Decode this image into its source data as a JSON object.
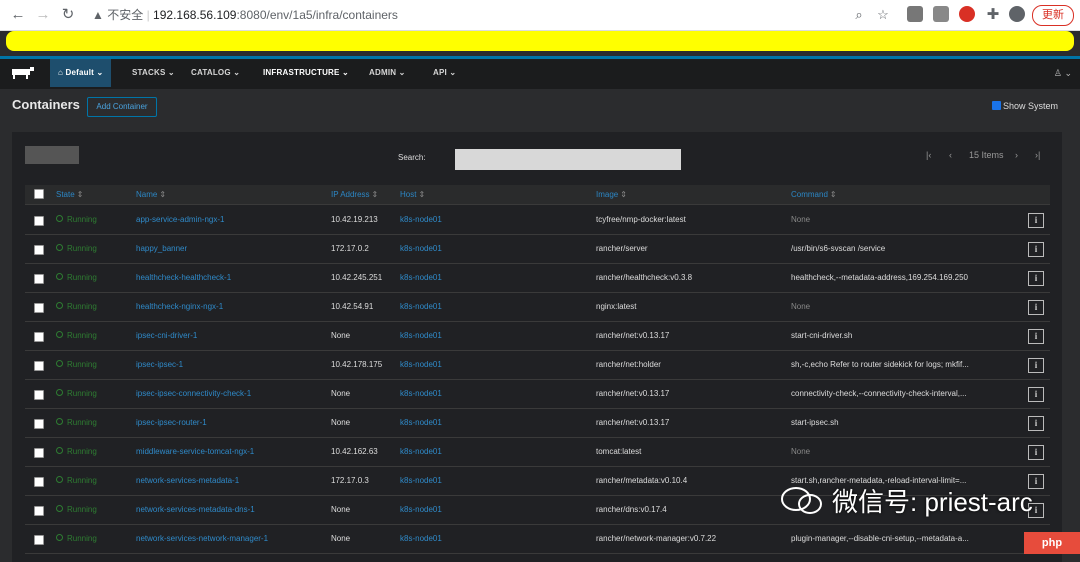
{
  "browser": {
    "security_text": "不安全",
    "url_host": "192.168.56.109",
    "url_port": ":8080",
    "url_path": "/env/1a5/infra/containers",
    "update_label": "更新"
  },
  "header": {
    "env_label": "Default",
    "menu": [
      "STACKS",
      "CATALOG",
      "INFRASTRUCTURE",
      "ADMIN",
      "API"
    ]
  },
  "page": {
    "title": "Containers",
    "add_button": "Add Container",
    "show_system": "Show System",
    "search_label": "Search:",
    "pager_text": "15 Items"
  },
  "table": {
    "columns": [
      "State",
      "Name",
      "IP Address",
      "Host",
      "Image",
      "Command"
    ],
    "rows": [
      {
        "state": "Running",
        "name": "app-service-admin-ngx-1",
        "ip": "10.42.19.213",
        "host": "k8s-node01",
        "image": "tcyfree/nmp-docker:latest",
        "command": "None"
      },
      {
        "state": "Running",
        "name": "happy_banner",
        "ip": "172.17.0.2",
        "host": "k8s-node01",
        "image": "rancher/server",
        "command": "/usr/bin/s6-svscan /service"
      },
      {
        "state": "Running",
        "name": "healthcheck-healthcheck-1",
        "ip": "10.42.245.251",
        "host": "k8s-node01",
        "image": "rancher/healthcheck:v0.3.8",
        "command": "healthcheck,--metadata-address,169.254.169.250"
      },
      {
        "state": "Running",
        "name": "healthcheck-nginx-ngx-1",
        "ip": "10.42.54.91",
        "host": "k8s-node01",
        "image": "nginx:latest",
        "command": "None"
      },
      {
        "state": "Running",
        "name": "ipsec-cni-driver-1",
        "ip": "None",
        "host": "k8s-node01",
        "image": "rancher/net:v0.13.17",
        "command": "start-cni-driver.sh"
      },
      {
        "state": "Running",
        "name": "ipsec-ipsec-1",
        "ip": "10.42.178.175",
        "host": "k8s-node01",
        "image": "rancher/net:holder",
        "command": "sh,-c,echo Refer to router sidekick for logs; mkfif..."
      },
      {
        "state": "Running",
        "name": "ipsec-ipsec-connectivity-check-1",
        "ip": "None",
        "host": "k8s-node01",
        "image": "rancher/net:v0.13.17",
        "command": "connectivity-check,--connectivity-check-interval,..."
      },
      {
        "state": "Running",
        "name": "ipsec-ipsec-router-1",
        "ip": "None",
        "host": "k8s-node01",
        "image": "rancher/net:v0.13.17",
        "command": "start-ipsec.sh"
      },
      {
        "state": "Running",
        "name": "middleware-service-tomcat-ngx-1",
        "ip": "10.42.162.63",
        "host": "k8s-node01",
        "image": "tomcat:latest",
        "command": "None"
      },
      {
        "state": "Running",
        "name": "network-services-metadata-1",
        "ip": "172.17.0.3",
        "host": "k8s-node01",
        "image": "rancher/metadata:v0.10.4",
        "command": "start.sh,rancher-metadata,-reload-interval-limit=..."
      },
      {
        "state": "Running",
        "name": "network-services-metadata-dns-1",
        "ip": "None",
        "host": "k8s-node01",
        "image": "rancher/dns:v0.17.4",
        "command": ""
      },
      {
        "state": "Running",
        "name": "network-services-network-manager-1",
        "ip": "None",
        "host": "k8s-node01",
        "image": "rancher/network-manager:v0.7.22",
        "command": "plugin-manager,--disable-cni-setup,--metadata-a..."
      }
    ]
  },
  "watermark": "微信号: priest-arc",
  "colors": {
    "accent": "#0075a8",
    "link": "#2f8ac9",
    "running": "#2e7d32",
    "highlight": "#ffff00"
  }
}
